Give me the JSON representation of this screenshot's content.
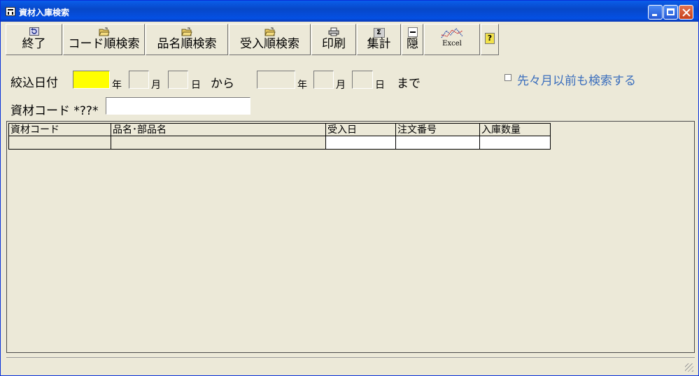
{
  "window": {
    "title": "資材入庫検索"
  },
  "toolbar": {
    "exit": "終了",
    "code_search": "コード順検索",
    "name_search": "品名順検索",
    "receipt_search": "受入順検索",
    "print": "印刷",
    "summary": "集計",
    "hide": "隠",
    "excel": "Excel",
    "sigma": "Σ",
    "help": "?"
  },
  "filter": {
    "date_label": "絞込日付",
    "year": "年",
    "month": "月",
    "day": "日",
    "from": "から",
    "to": "まで",
    "from_year": "",
    "from_month": "",
    "from_day": "",
    "to_year": "",
    "to_month": "",
    "to_day": "",
    "include_label": "先々月以前も検索する",
    "include_checked": false,
    "code_label": "資材コード *??*",
    "code_value": ""
  },
  "table": {
    "columns": [
      "資材コード",
      "品名･部品名",
      "受入日",
      "注文番号",
      "入庫数量"
    ],
    "rows": [
      [
        "",
        "",
        "",
        "",
        ""
      ]
    ]
  },
  "colors": {
    "title_bar": "#0A5EEA",
    "highlight_field": "#FFFF00",
    "link_text": "#3C6FBD",
    "background": "#ECE9D8"
  }
}
